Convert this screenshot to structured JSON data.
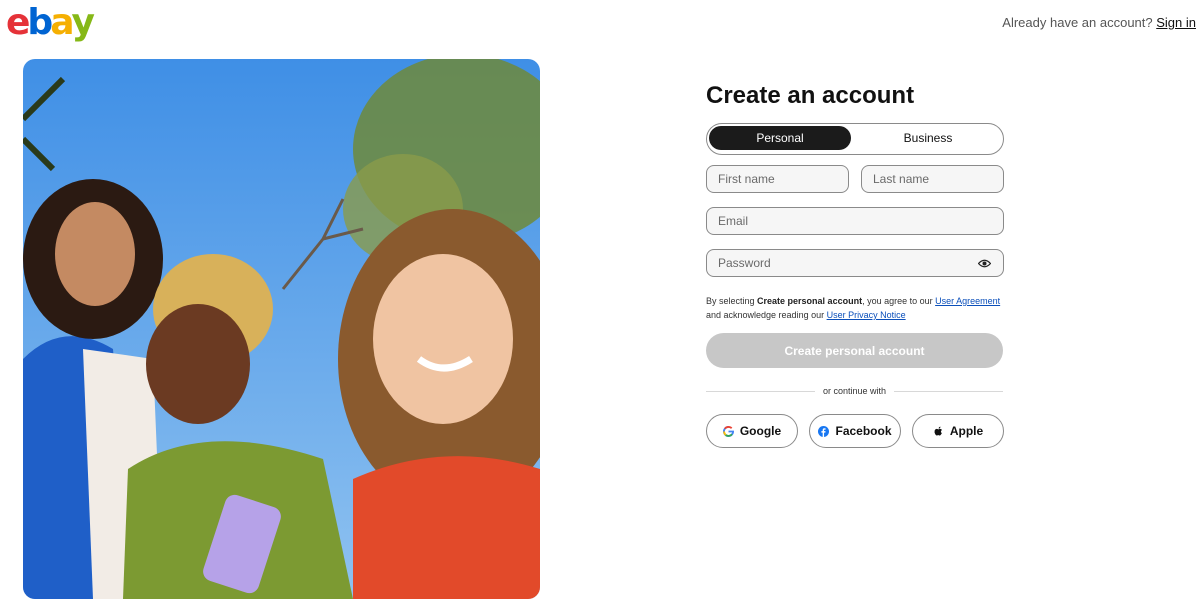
{
  "logo": {
    "letters": [
      "e",
      "b",
      "a",
      "y"
    ],
    "colors": [
      "#e53238",
      "#0064d2",
      "#f5af02",
      "#86b817"
    ]
  },
  "header": {
    "prompt": "Already have an account?",
    "sign_in": "Sign in"
  },
  "form": {
    "title": "Create an account",
    "tabs": [
      {
        "label": "Personal",
        "active": true
      },
      {
        "label": "Business",
        "active": false
      }
    ],
    "fields": {
      "first_name": "First name",
      "last_name": "Last name",
      "email": "Email",
      "password": "Password"
    },
    "legal": {
      "part1": "By selecting ",
      "bold": "Create personal account",
      "part2": ", you agree to our ",
      "link1": "User Agreement",
      "part3": " and acknowledge reading our ",
      "link2": "User Privacy Notice"
    },
    "submit": "Create personal account",
    "divider": "or continue with",
    "social": [
      {
        "label": "Google",
        "icon": "google-icon"
      },
      {
        "label": "Facebook",
        "icon": "facebook-icon"
      },
      {
        "label": "Apple",
        "icon": "apple-icon"
      }
    ]
  },
  "colors": {
    "primary_dark": "#1b1b1b",
    "disabled_button": "#c7c7c7",
    "link": "#0b4fba"
  }
}
